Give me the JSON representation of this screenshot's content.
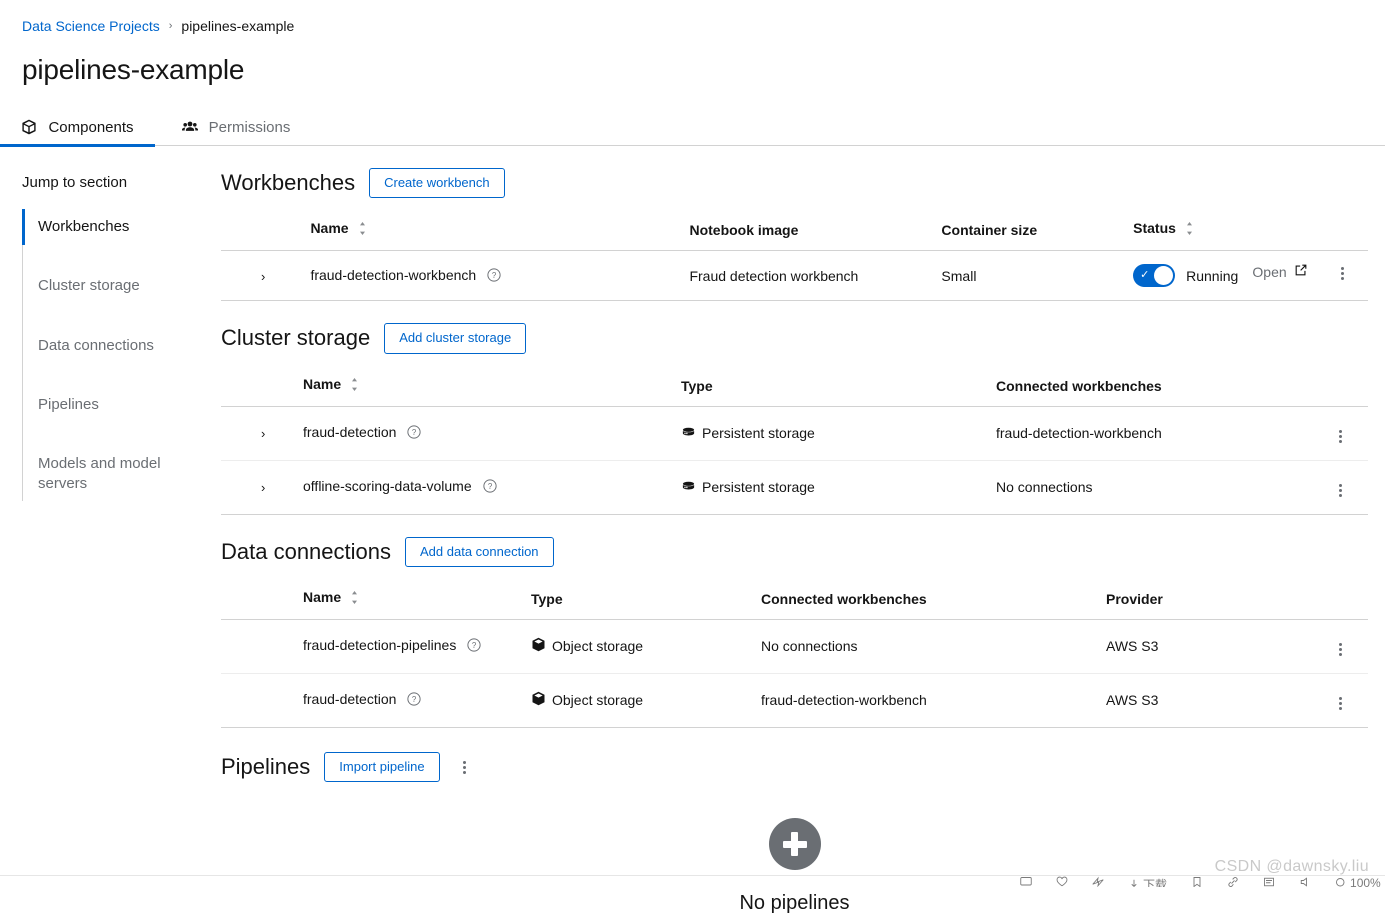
{
  "breadcrumb": {
    "root": "Data Science Projects",
    "separator": "›",
    "current": "pipelines-example"
  },
  "page_title": "pipelines-example",
  "tabs": [
    {
      "label": "Components",
      "icon": "cube-icon",
      "active": true
    },
    {
      "label": "Permissions",
      "icon": "users-icon",
      "active": false
    }
  ],
  "jump_to_section": {
    "title": "Jump to section",
    "items": [
      {
        "label": "Workbenches",
        "active": true
      },
      {
        "label": "Cluster storage",
        "active": false
      },
      {
        "label": "Data connections",
        "active": false
      },
      {
        "label": "Pipelines",
        "active": false
      },
      {
        "label": "Models and model servers",
        "active": false
      }
    ]
  },
  "workbenches": {
    "title": "Workbenches",
    "action_label": "Create workbench",
    "columns": [
      "Name",
      "Notebook image",
      "Container size",
      "Status"
    ],
    "rows": [
      {
        "name": "fraud-detection-workbench",
        "notebook_image": "Fraud detection workbench",
        "container_size": "Small",
        "status": "Running",
        "status_on": true,
        "open_label": "Open"
      }
    ]
  },
  "cluster_storage": {
    "title": "Cluster storage",
    "action_label": "Add cluster storage",
    "columns": [
      "Name",
      "Type",
      "Connected workbenches"
    ],
    "rows": [
      {
        "name": "fraud-detection",
        "type": "Persistent storage",
        "type_icon": "database-icon",
        "connected_workbenches": "fraud-detection-workbench"
      },
      {
        "name": "offline-scoring-data-volume",
        "type": "Persistent storage",
        "type_icon": "database-icon",
        "connected_workbenches": "No connections"
      }
    ]
  },
  "data_connections": {
    "title": "Data connections",
    "action_label": "Add data connection",
    "columns": [
      "Name",
      "Type",
      "Connected workbenches",
      "Provider"
    ],
    "rows": [
      {
        "name": "fraud-detection-pipelines",
        "type": "Object storage",
        "type_icon": "cube-icon",
        "connected_workbenches": "No connections",
        "provider": "AWS S3"
      },
      {
        "name": "fraud-detection",
        "type": "Object storage",
        "type_icon": "cube-icon",
        "connected_workbenches": "fraud-detection-workbench",
        "provider": "AWS S3"
      }
    ]
  },
  "pipelines": {
    "title": "Pipelines",
    "action_label": "Import pipeline",
    "empty_title": "No pipelines"
  },
  "watermark": "CSDN @dawnsky.liu",
  "bottom_toolbar": [
    {
      "icon": "comment-icon",
      "label": ""
    },
    {
      "icon": "heart-icon",
      "label": ""
    },
    {
      "icon": "share-icon",
      "label": ""
    },
    {
      "icon": "download-icon",
      "label": "下载"
    },
    {
      "icon": "bookmark-icon",
      "label": ""
    },
    {
      "icon": "link-icon",
      "label": ""
    },
    {
      "icon": "note-icon",
      "label": ""
    },
    {
      "icon": "sound-icon",
      "label": ""
    },
    {
      "icon": "zoom-icon",
      "label": "100%"
    }
  ],
  "colors": {
    "accent": "#0066cc",
    "text": "#151515",
    "muted": "#6a6e73",
    "border": "#d2d2d2",
    "empty_circle": "#6a6e73"
  }
}
